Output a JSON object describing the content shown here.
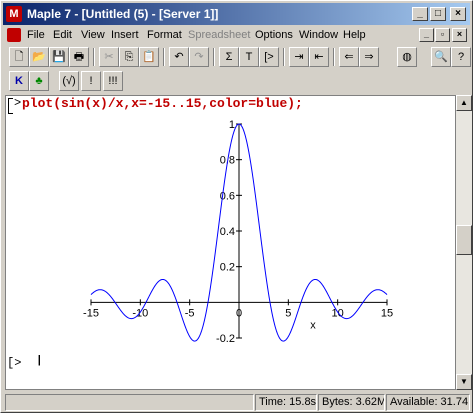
{
  "window": {
    "title": "Maple 7 - [Untitled (5) - [Server 1]]",
    "app_icon_glyph": "M",
    "controls": {
      "minimize": "_",
      "maximize": "□",
      "close": "×"
    }
  },
  "menu": {
    "items": [
      "File",
      "Edit",
      "View",
      "Insert",
      "Format",
      "Spreadsheet",
      "Options",
      "Window",
      "Help"
    ],
    "disabled": [
      "Spreadsheet"
    ]
  },
  "toolbar1": {
    "buttons": [
      "new",
      "open",
      "save",
      "print",
      "cut",
      "copy",
      "paste",
      "undo",
      "redo",
      "Σ",
      "T",
      "[>",
      "indent",
      "outdent",
      "back",
      "forward",
      "stop",
      "zoom",
      "help"
    ]
  },
  "toolbar2": {
    "buttons": [
      "K",
      "♣",
      "(√)",
      "!",
      "!!!"
    ]
  },
  "document": {
    "command": "plot(sin(x)/x,x=-15..15,color=blue);",
    "prompt_glyph": ">",
    "new_prompt": "[>",
    "cursor": "|"
  },
  "chart_data": {
    "type": "line",
    "function": "sin(x)/x",
    "series": [
      {
        "name": "",
        "color": "#0000ff"
      }
    ],
    "xlim": [
      -15,
      15
    ],
    "ylim": [
      -0.2,
      1
    ],
    "xticks": [
      -15,
      -10,
      -5,
      0,
      5,
      10,
      15
    ],
    "xtick_labels": [
      "-15",
      "-10",
      "-5",
      "0",
      "5",
      "10",
      "15"
    ],
    "yticks": [
      -0.2,
      0.2,
      0.4,
      0.6,
      0.8,
      1
    ],
    "ytick_labels": [
      "-0.2",
      "0.2",
      "0.4",
      "0.6",
      "0.8",
      "1"
    ],
    "xlabel": "x",
    "ylabel": ""
  },
  "status": {
    "time": "Time: 15.8s",
    "bytes": "Bytes: 3.62M",
    "available": "Available: 31.74"
  }
}
